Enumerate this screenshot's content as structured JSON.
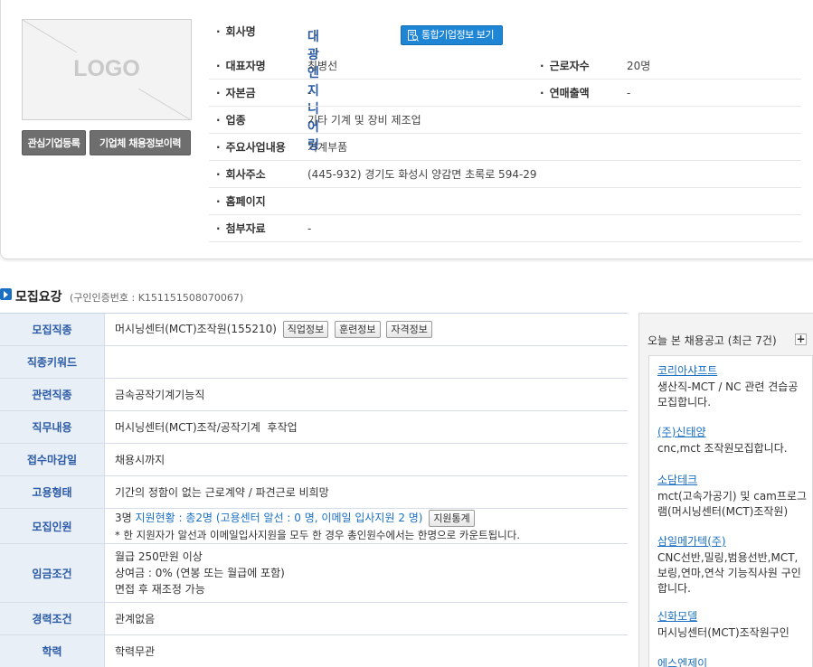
{
  "company": {
    "logo_text": "LOGO",
    "fav_button": "관심기업등록",
    "history_button": "기업체 채용정보이력",
    "name_label": "회사명",
    "name": "대광엔지니어링",
    "integrated_button": "통합기업정보 보기",
    "ceo_label": "대표자명",
    "ceo": "최병선",
    "employees_label": "근로자수",
    "employees": "20명",
    "capital_label": "자본금",
    "capital": "-",
    "sales_label": "연매출액",
    "sales": "-",
    "industry_label": "업종",
    "industry": "기타 기계 및 장비 제조업",
    "business_label": "주요사업내용",
    "business": "기계부품",
    "address_label": "회사주소",
    "address": "(445-932) 경기도 화성시 양감면 초록로 594-29",
    "homepage_label": "홈페이지",
    "homepage": "",
    "attachment_label": "첨부자료",
    "attachment": "-"
  },
  "section": {
    "title": "모집요강",
    "subtitle": "(구인인증번호 : K151151508070067)"
  },
  "recruit": {
    "job_label": "모집직종",
    "job_value": "머시닝센터(MCT)조작원(155210)",
    "job_btn1": "직업정보",
    "job_btn2": "훈련정보",
    "job_btn3": "자격정보",
    "keyword_label": "직종키워드",
    "keyword_value": "",
    "related_label": "관련직종",
    "related_value": "금속공작기계기능직",
    "duty_label": "직무내용",
    "duty_value": "머시닝센터(MCT)조작/공작기계  후작업",
    "deadline_label": "접수마감일",
    "deadline_value": "채용시까지",
    "employ_type_label": "고용형태",
    "employ_type_value": "기간의 정함이 없는 근로계약 / 파견근로 비희망",
    "headcount_label": "모집인원",
    "headcount_prefix": "3명",
    "headcount_status": "지원현황 : 총2명 (고용센터 알선 : 0 명, 이메일 입사지원 2 명)",
    "headcount_btn": "지원통계",
    "headcount_note": "* 한 지원자가 알선과 이메일입사지원을 모두 한 경우 총인원수에서는 한명으로 카운트됩니다.",
    "wage_label": "임금조건",
    "wage_line1": "월급 250만원 이상",
    "wage_line2": "상여금 : 0% (연봉 또는 월급에 포함)",
    "wage_line3": "면접 후 재조정 가능",
    "career_label": "경력조건",
    "career_value": "관계없음",
    "edu_label": "학력",
    "edu_value": "학력무관"
  },
  "side": {
    "title": "오늘 본 채용공고 (최근 7건)",
    "plus": "+",
    "items": [
      {
        "company": "코리아샤프트",
        "desc": "생산직-MCT / NC 관련 견습공 모집합니다."
      },
      {
        "company": "(주)신태양",
        "desc": "cnc,mct 조작원모집합니다."
      },
      {
        "company": "소담테크",
        "desc": "mct(고속가공기) 및 cam프로그램(머시닝센터(MCT)조작원)"
      },
      {
        "company": "삼일메가텍(주)",
        "desc": "CNC선반,밀링,범용선반,MCT,보링,연마,연삭 기능직사원 구인합니다."
      },
      {
        "company": "신화모델",
        "desc": "머시닝센터(MCT)조작원구인"
      },
      {
        "company": "에스엔제이",
        "desc": ""
      }
    ]
  },
  "colors": {
    "link_blue": "#1a6fc2",
    "header_bg": "#e9eff7",
    "button_blue": "#1f86d6",
    "button_gray": "#6e6e6e"
  }
}
